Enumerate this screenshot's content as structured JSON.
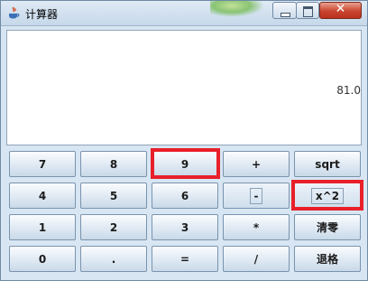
{
  "window": {
    "title": "计算器",
    "colors": {
      "highlight": "#e8202a",
      "title_bar": "#c6d8ea",
      "close_button": "#c9452f"
    }
  },
  "display": {
    "value": "81.0"
  },
  "keys": [
    [
      "7",
      "8",
      "9",
      "+",
      "sqrt"
    ],
    [
      "4",
      "5",
      "6",
      "-",
      "x^2"
    ],
    [
      "1",
      "2",
      "3",
      "*",
      "清零"
    ],
    [
      "0",
      ".",
      "=",
      "/",
      "退格"
    ]
  ],
  "icons": {
    "app": "java-coffee-cup-icon",
    "minimize": "minimize-icon",
    "maximize": "maximize-icon",
    "close": "close-icon"
  }
}
